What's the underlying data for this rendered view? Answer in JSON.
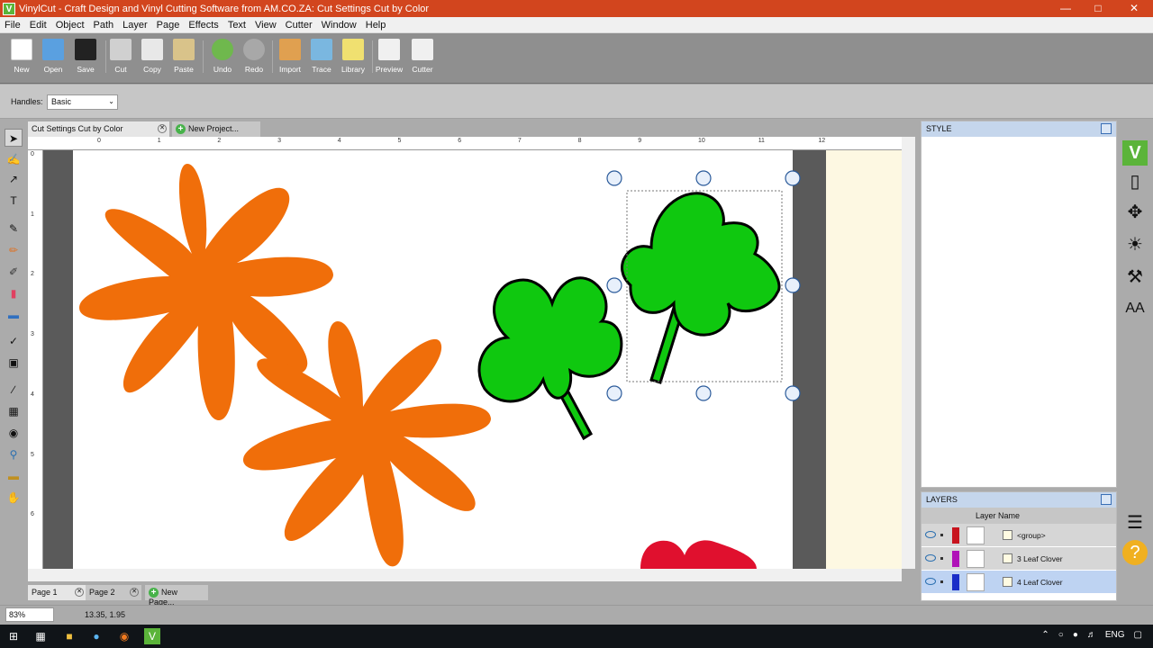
{
  "window": {
    "title": "VinylCut - Craft Design and Vinyl Cutting Software from AM.CO.ZA: Cut Settings Cut by Color",
    "app_icon_letter": "V"
  },
  "menu": [
    "File",
    "Edit",
    "Object",
    "Path",
    "Layer",
    "Page",
    "Effects",
    "Text",
    "View",
    "Cutter",
    "Window",
    "Help"
  ],
  "toolbar": {
    "new": "New",
    "open": "Open",
    "save": "Save",
    "cut": "Cut",
    "copy": "Copy",
    "paste": "Paste",
    "undo": "Undo",
    "redo": "Redo",
    "import": "Import",
    "trace": "Trace",
    "library": "Library",
    "preview": "Preview",
    "cutter": "Cutter"
  },
  "handles": {
    "label": "Handles:",
    "value": "Basic"
  },
  "doc_tabs": {
    "active": "Cut Settings Cut by Color",
    "new": "New Project..."
  },
  "ruler": {
    "h": [
      "0",
      "1",
      "2",
      "3",
      "4",
      "5",
      "6",
      "7",
      "8",
      "9",
      "10",
      "11",
      "12"
    ],
    "v": [
      "0",
      "1",
      "2",
      "3",
      "4",
      "5",
      "6"
    ]
  },
  "page_tabs": {
    "page1": "Page 1",
    "page2": "Page 2",
    "new": "New Page..."
  },
  "status": {
    "zoom": "83%",
    "coords": "13.35, 1.95"
  },
  "style_panel": {
    "title": "STYLE"
  },
  "layers_panel": {
    "title": "LAYERS",
    "column": "Layer Name",
    "rows": [
      {
        "name": "<group>",
        "color": "#c8141e"
      },
      {
        "name": "3 Leaf Clover",
        "color": "#b012b8"
      },
      {
        "name": "4 Leaf Clover",
        "color": "#1a2ec8"
      }
    ]
  },
  "colors": {
    "orange": "#f06e0a",
    "green": "#0fc80f",
    "red": "#e0102e",
    "titlebar": "#d2451e"
  },
  "taskbar": {
    "language": "ENG"
  }
}
